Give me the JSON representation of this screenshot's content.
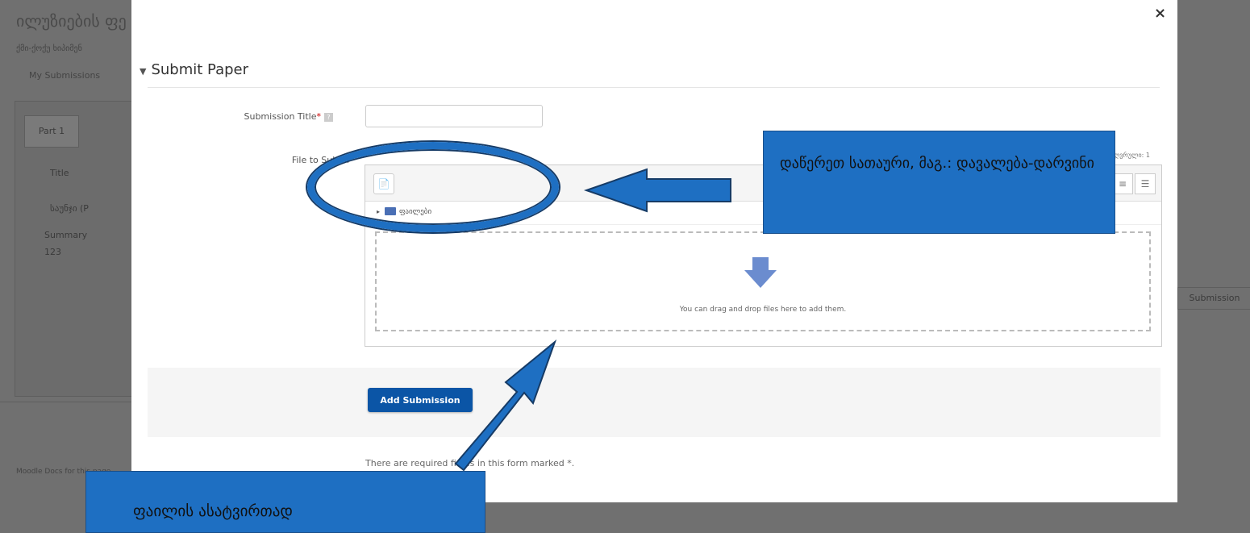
{
  "background": {
    "course_title": "ილუზიების ფე",
    "breadcrumb": "ქმი-ქოქუ ხიპიმენ",
    "nav_link": "My Submissions",
    "part_tab": "Part 1",
    "col_title": "Title",
    "row_prefix": "საუნჯი (P",
    "summary_label": "Summary",
    "summary_value": "123",
    "submissions_button": "Submission",
    "footer_text": "Moodle Docs for this page"
  },
  "modal": {
    "close": "×",
    "legend": "Submit Paper",
    "submission_title_label": "Submission Title",
    "submission_title_value": "",
    "file_label": "File to Submi",
    "max_size": "ზღვრული: 1",
    "filepicker": {
      "add_icon": "📄",
      "path_name": "ფაილები",
      "drop_text": "You can drag and drop files here to add them."
    },
    "submit_button": "Add Submission",
    "required_note": "There are required fields in this form marked *."
  },
  "annotations": {
    "callout_title": "დაწერეთ სათაური, მაგ.: დავალება-დარვინი",
    "callout_file": "ფაილის ასატვირთად",
    "accent_color": "#1e6fc2"
  }
}
